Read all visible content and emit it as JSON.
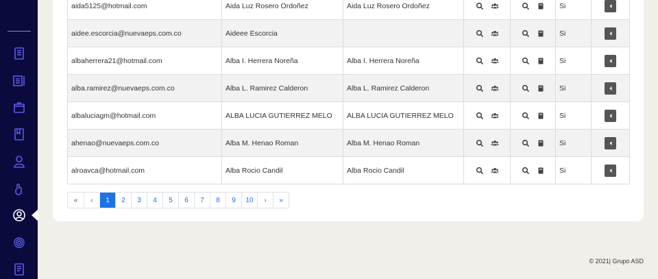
{
  "sidebar": {
    "icons": [
      "document-icon",
      "list-icon",
      "box-icon",
      "book-icon",
      "user-icon",
      "hand-icon",
      "user-circle-icon",
      "fingerprint-icon",
      "notebook-icon"
    ],
    "active": "user-circle-icon"
  },
  "table": {
    "rows": [
      {
        "email": "aida5125@hotmail.com",
        "name": "Aida Luz Rosero Ordoñez",
        "display": "Aida Luz Rosero Ordoñez",
        "status": "Si"
      },
      {
        "email": "aidee.escorcia@nuevaeps.com.co",
        "name": "Aideee Escorcia",
        "display": "",
        "status": "Si"
      },
      {
        "email": "albaherrera21@hotmail.com",
        "name": "Alba I. Herrera Noreña",
        "display": "Alba I. Herrera Noreña",
        "status": "Si"
      },
      {
        "email": "alba.ramirez@nuevaeps.com.co",
        "name": "Alba L. Ramirez Calderon",
        "display": "Alba L. Ramirez Calderon",
        "status": "Si"
      },
      {
        "email": "albaluciagm@hotmail.com",
        "name": "ALBA LUCIA GUTIERREZ MELO",
        "display": "ALBA LUCIA GUTIERREZ MELO",
        "status": "Si"
      },
      {
        "email": "ahenao@nuevaeps.com.co",
        "name": "Alba M. Henao Roman",
        "display": "Alba M. Henao Roman",
        "status": "Si"
      },
      {
        "email": "alroavca@hotmail.com",
        "name": "Alba Rocio Candil",
        "display": "Alba Rocio Candil",
        "status": "Si"
      }
    ]
  },
  "pagination": {
    "first": "«",
    "prev": "‹",
    "pages": [
      "1",
      "2",
      "3",
      "4",
      "5",
      "6",
      "7",
      "8",
      "9",
      "10"
    ],
    "active": "1",
    "next": "›",
    "last": "»"
  },
  "footer": {
    "text": "© 2021| Grupo ASD"
  },
  "colors": {
    "sidebar": "#0b0a3d",
    "sidebar_icon": "#5b5be8",
    "accent": "#1a73e8",
    "button_dark": "#555555"
  }
}
